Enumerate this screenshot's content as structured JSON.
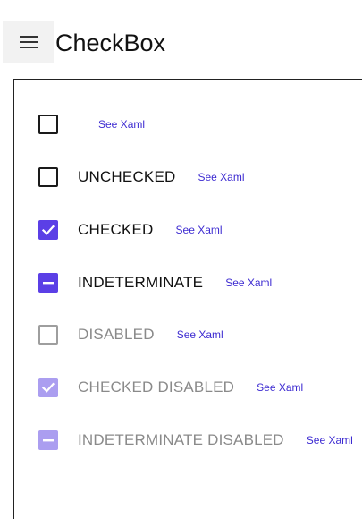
{
  "header": {
    "title": "CheckBox",
    "menu_icon": "hamburger-menu-icon"
  },
  "colors": {
    "accent": "#5b3fe6",
    "accent_disabled": "#ab9ef0",
    "link": "#3d2bd1"
  },
  "rows": [
    {
      "state": "unchecked",
      "label": "",
      "link": "See Xaml",
      "disabled": false
    },
    {
      "state": "unchecked",
      "label": "UNCHECKED",
      "link": "See Xaml",
      "disabled": false
    },
    {
      "state": "checked",
      "label": "CHECKED",
      "link": "See Xaml",
      "disabled": false
    },
    {
      "state": "indeterminate",
      "label": "INDETERMINATE",
      "link": "See Xaml",
      "disabled": false
    },
    {
      "state": "unchecked",
      "label": "DISABLED",
      "link": "See Xaml",
      "disabled": true
    },
    {
      "state": "checked",
      "label": "CHECKED DISABLED",
      "link": "See Xaml",
      "disabled": true
    },
    {
      "state": "indeterminate",
      "label": "INDETERMINATE DISABLED",
      "link": "See Xaml",
      "disabled": true
    }
  ]
}
